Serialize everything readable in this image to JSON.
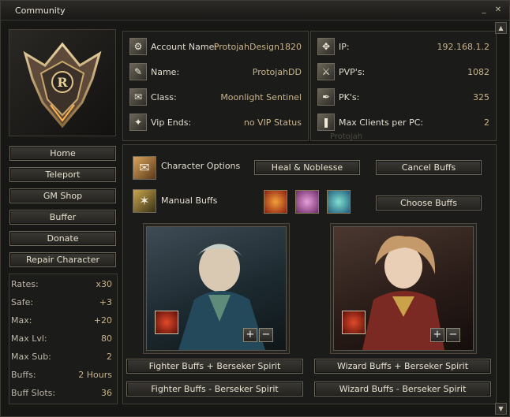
{
  "window": {
    "title": "Community"
  },
  "account": {
    "rows": [
      {
        "icon": "account-icon",
        "glyph": "⚙",
        "label": "Account Name:",
        "value": "ProtojahDesign1820"
      },
      {
        "icon": "name-icon",
        "glyph": "✎",
        "label": "Name:",
        "value": "ProtojahDD"
      },
      {
        "icon": "class-icon",
        "glyph": "✉",
        "label": "Class:",
        "value": "Moonlight Sentinel"
      },
      {
        "icon": "vip-icon",
        "glyph": "✦",
        "label": "Vip Ends:",
        "value": "no VIP Status"
      }
    ]
  },
  "server": {
    "rows": [
      {
        "icon": "ip-icon",
        "glyph": "✥",
        "label": "IP:",
        "value": "192.168.1.2"
      },
      {
        "icon": "pvp-icon",
        "glyph": "⚔",
        "label": "PVP's:",
        "value": "1082"
      },
      {
        "icon": "pk-icon",
        "glyph": "✒",
        "label": "PK's:",
        "value": "325"
      },
      {
        "icon": "clients-icon",
        "glyph": "❚",
        "label": "Max Clients per PC:",
        "value": "2"
      }
    ],
    "ghost_text": "Protojah"
  },
  "nav": [
    "Home",
    "Teleport",
    "GM Shop",
    "Buffer",
    "Donate",
    "Repair Character"
  ],
  "stats": [
    {
      "label": "Rates:",
      "value": "x30"
    },
    {
      "label": "Safe:",
      "value": "+3"
    },
    {
      "label": "Max:",
      "value": "+20"
    },
    {
      "label": "Max Lvl:",
      "value": "80"
    },
    {
      "label": "Max Sub:",
      "value": "2"
    },
    {
      "label": "Buffs:",
      "value": "2 Hours"
    },
    {
      "label": "Buff Slots:",
      "value": "36"
    }
  ],
  "options": {
    "character_options": "Character Options",
    "manual_buffs": "Manual Buffs",
    "heal_noblesse": "Heal & Noblesse",
    "cancel_buffs": "Cancel Buffs",
    "choose_buffs": "Choose Buffs"
  },
  "logo": {
    "letter": "R"
  },
  "skills": [
    {
      "name": "fire-skill-icon",
      "colors": [
        "#f2a13a",
        "#8c1d10"
      ]
    },
    {
      "name": "spirit-skill-icon",
      "colors": [
        "#e7a0d8",
        "#6a2a6a"
      ]
    },
    {
      "name": "wind-skill-icon",
      "colors": [
        "#7fe0d0",
        "#1f5a7a"
      ]
    }
  ],
  "buff_buttons": {
    "fighter_plus": "Fighter Buffs + Berseker Spirit",
    "fighter_minus": "Fighter Buffs - Berseker Spirit",
    "wizard_plus": "Wizard Buffs + Berseker Spirit",
    "wizard_minus": "Wizard Buffs - Berseker Spirit"
  },
  "symbols": {
    "plus": "+",
    "minus": "−",
    "min": "_",
    "close": "✕",
    "up": "▲",
    "down": "▼"
  }
}
